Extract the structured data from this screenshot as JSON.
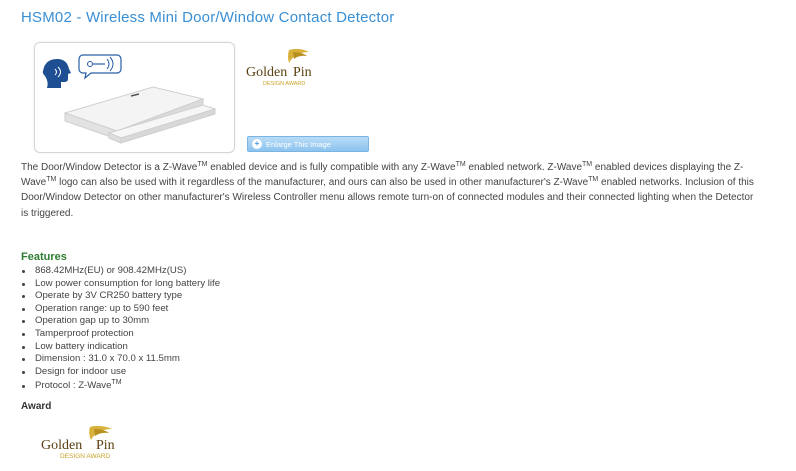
{
  "title": "HSM02 - Wireless Mini Door/Window Contact Detector",
  "enlarge_label": "Enlarge This Image",
  "award_logo": {
    "word1": "Golden",
    "word2": "Pin",
    "subtitle": "DESIGN AWARD",
    "gold_color": "#c9a227",
    "dark_color": "#5a3f10"
  },
  "description": {
    "p1": "The Door/Window Detector is a Z-Wave",
    "p2": " enabled device and is fully compatible with any Z-Wave",
    "p3": " enabled network. Z-Wave",
    "p4": " enabled devices displaying the Z-Wave",
    "p5": " logo can also be used with it regardless of the manufacturer, and ours can also be used in other manufacturer's Z-Wave",
    "p6": " enabled networks.  Inclusion of this Door/Window Detector on other manufacturer's Wireless Controller menu allows remote turn-on of connected modules and their connected lighting when the Detector is triggered.",
    "tm": "TM"
  },
  "features_title": "Features",
  "features": [
    "868.42MHz(EU) or 908.42MHz(US)",
    "Low power consumption for long battery life",
    "Operate by 3V CR250 battery type",
    "Operation range: up to 590 feet",
    "Operation gap up to 30mm",
    "Tamperproof protection",
    "Low battery indication",
    "Dimension : 31.0 x 70.0 x 11.5mm",
    "Design for indoor use"
  ],
  "protocol_label": "Protocol : Z-Wave",
  "tm": "TM",
  "award_heading": "Award",
  "colors": {
    "title": "#3a8fd4",
    "features_title": "#2e7d32"
  }
}
